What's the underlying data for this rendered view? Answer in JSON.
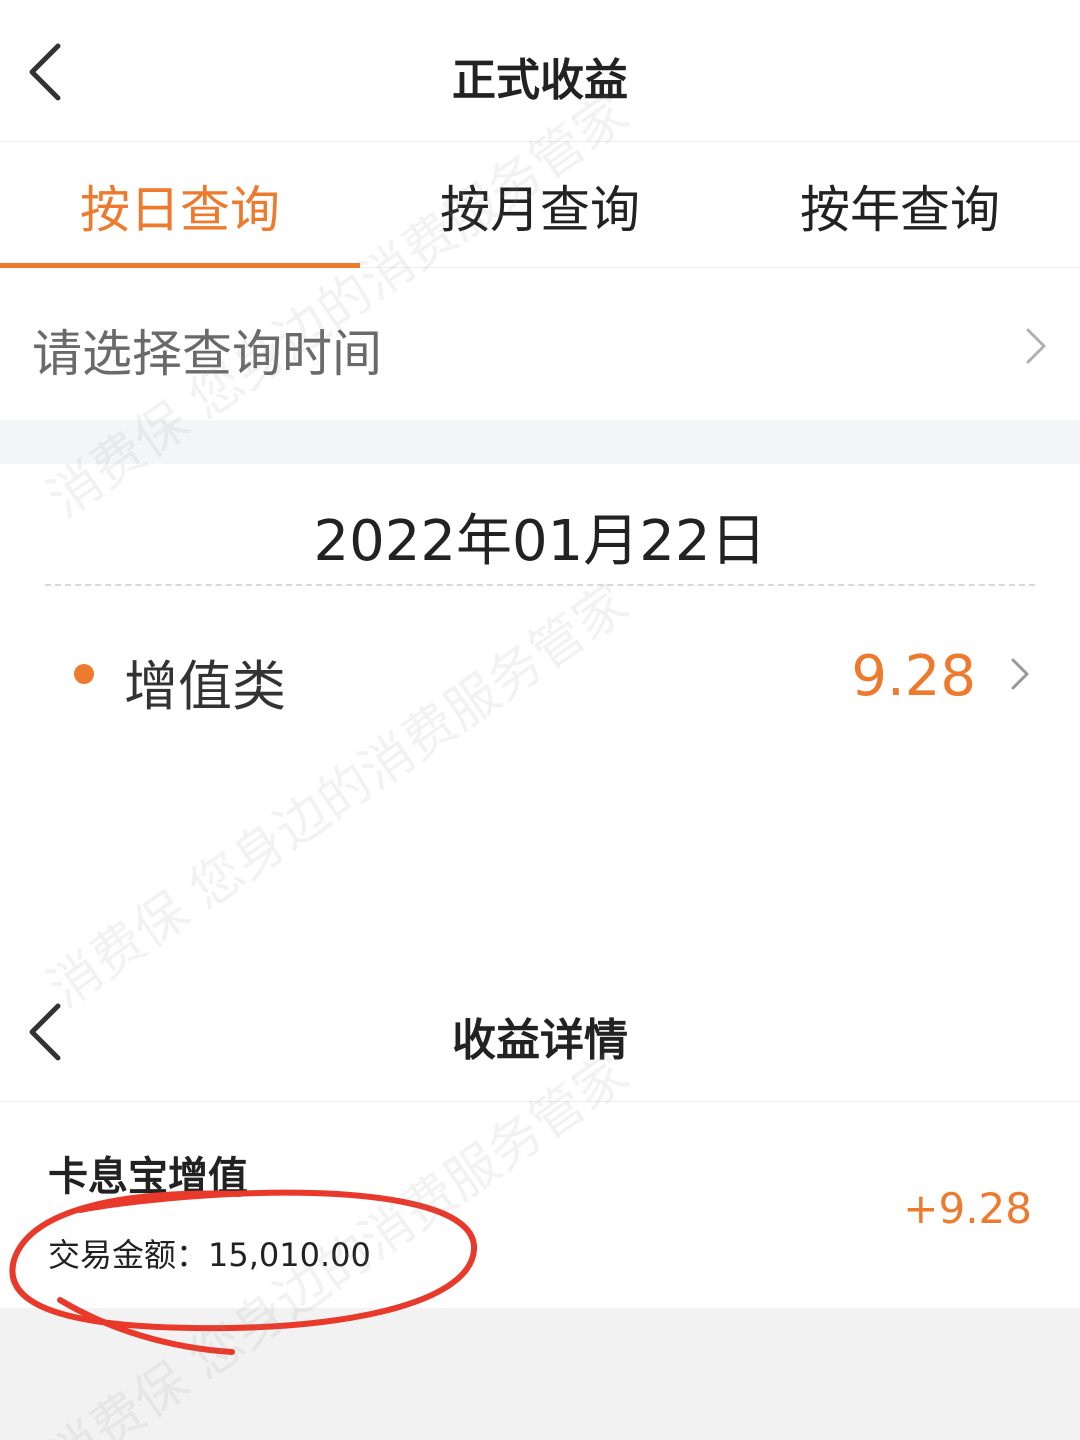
{
  "header": {
    "title": "正式收益",
    "back_icon": "chevron-left-icon"
  },
  "tabs": [
    {
      "label": "按日查询",
      "active": true
    },
    {
      "label": "按月查询",
      "active": false
    },
    {
      "label": "按年查询",
      "active": false
    }
  ],
  "query": {
    "label": "请选择查询时间",
    "icon": "chevron-right-icon"
  },
  "date": "2022年01月22日",
  "income_item": {
    "name": "增值类",
    "value": "9.28"
  },
  "detail_header": {
    "title": "收益详情",
    "back_icon": "chevron-left-icon"
  },
  "detail": {
    "name": "卡息宝增值",
    "amount_label": "交易金额：",
    "amount": "15,010.00",
    "value": "+9.28"
  },
  "watermark": {
    "lines": [
      "消费保 您身边的消费服务管家",
      "消费保 您身边的消费服务管家",
      "消费保 您身边的消费服务管家"
    ]
  },
  "colors": {
    "accent": "#ee7a2e",
    "annotation": "#e8392a",
    "gap": "#f4f5f9"
  }
}
